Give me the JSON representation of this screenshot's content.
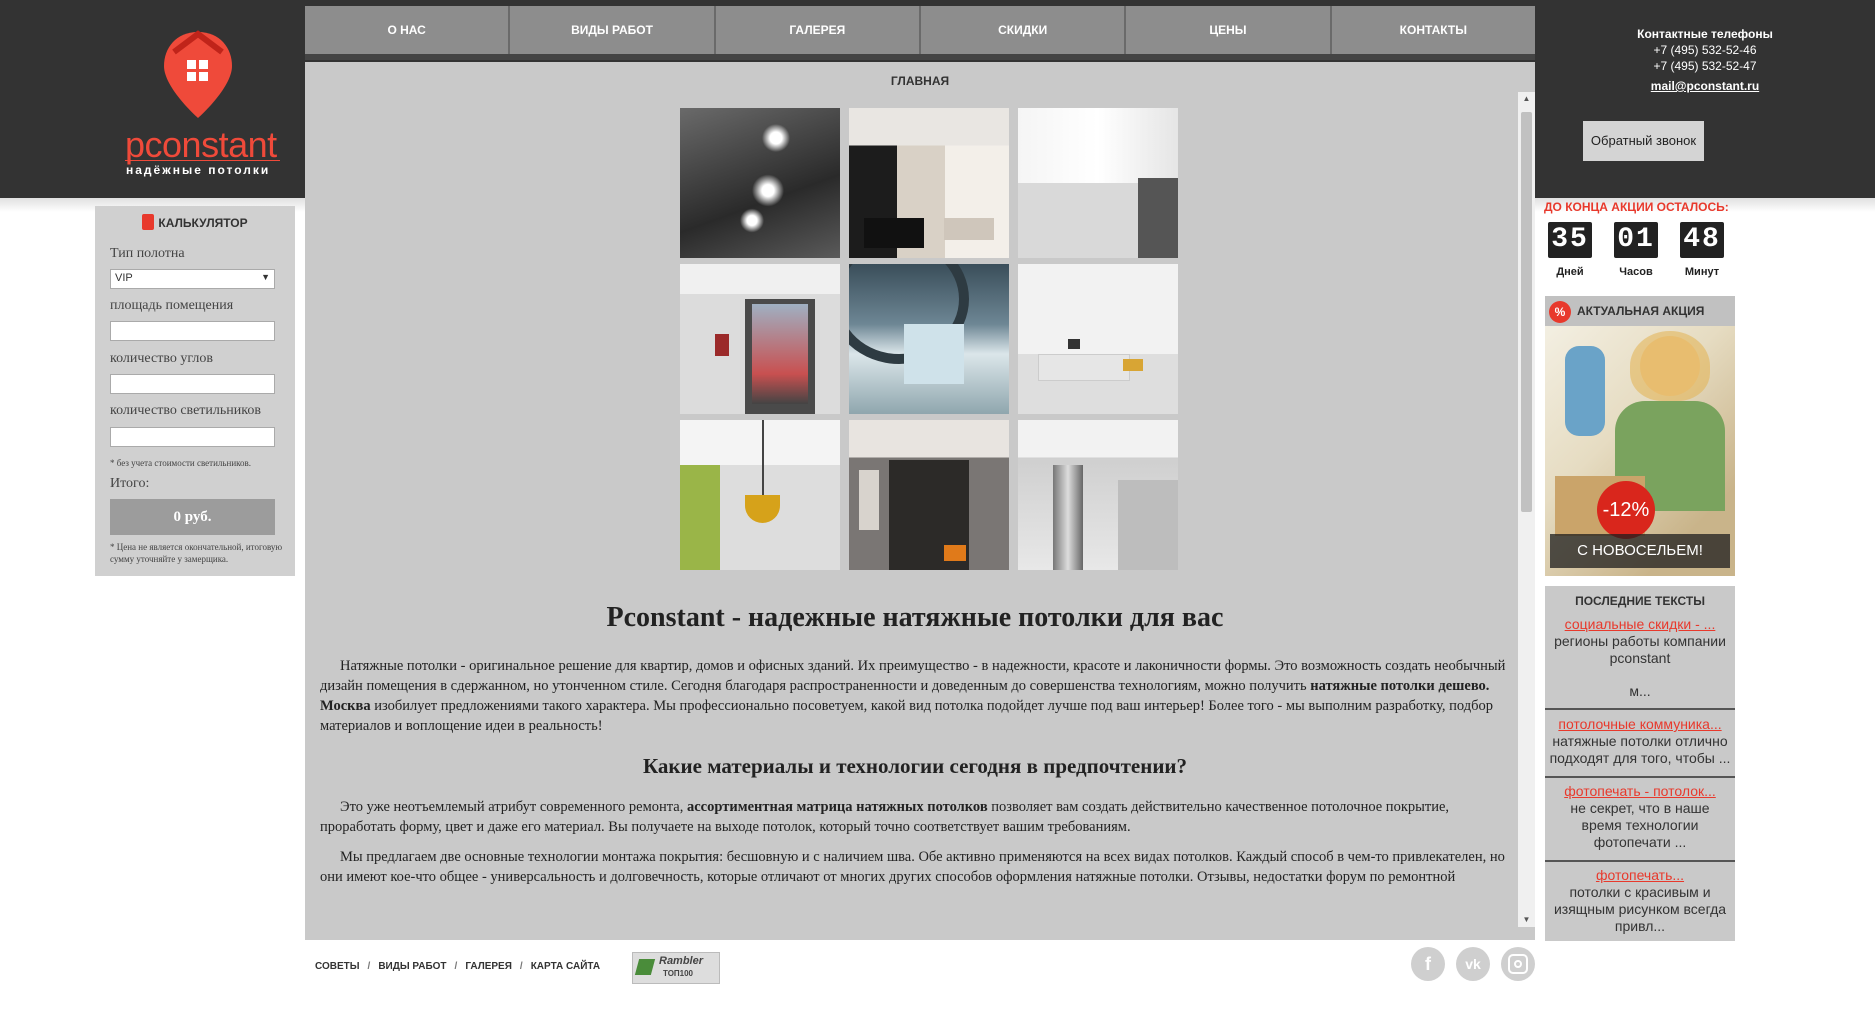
{
  "nav": [
    "О НАС",
    "ВИДЫ РАБОТ",
    "ГАЛЕРЕЯ",
    "СКИДКИ",
    "ЦЕНЫ",
    "КОНТАКТЫ"
  ],
  "logo": {
    "word": "pconstant",
    "sub": "надёжные потолки"
  },
  "breadcrumb": "ГЛАВНАЯ",
  "content": {
    "h1": "Pconstant - надежные натяжные потолки для вас",
    "p1_a": "Натяжные потолки - оригинальное решение для квартир, домов и офисных зданий. Их преимущество - в надежности, красоте и лаконичности формы. Это возможность создать необычный дизайн помещения в сдержанном, но утонченном стиле. Сегодня благодаря распространенности и доведенным до совершенства технологиям, можно получить ",
    "p1_b": "натяжные потолки дешево. Москва",
    "p1_c": " изобилует предложениями такого характера. Мы профессионально посоветуем, какой вид потолка подойдет лучше под ваш интерьер! Более того - мы выполним разработку, подбор материалов и воплощение идеи в реальность!",
    "h2": "Какие материалы и технологии сегодня в предпочтении?",
    "p2_a": "Это уже неотъемлемый атрибут современного ремонта, ",
    "p2_b": "ассортиментная матрица натяжных потолков",
    "p2_c": " позволяет вам создать действительно качественное потолочное покрытие, проработать форму, цвет и даже его материал. Вы получаете на выходе потолок, который точно соответствует вашим требованиям.",
    "p3": "Мы предлагаем две основные технологии монтажа покрытия: бесшовную и с наличием шва. Обе активно применяются на всех видах потолков. Каждый способ в чем-то привлекателен, но они имеют кое-что общее - универсальность и долговечность, которые отличают от многих других способов оформления натяжные потолки. Отзывы, недостатки форум по ремонтной тематике раскрывает несколько шире: в основном пользователи относят к минусу таких потолков их стоимость, однако она очень различна в"
  },
  "calculator": {
    "title": "КАЛЬКУЛЯТОР",
    "type_label": "Тип полотна",
    "type_value": "VIP",
    "area_label": "площадь помещения",
    "corners_label": "количество углов",
    "lamps_label": "количество светильников",
    "lamps_note": "* без учета стоимости светильников.",
    "total_label": "Итого:",
    "total_value": "0 руб.",
    "final_note": "* Цена не является окончательной, итоговую сумму уточняйте у замерщика."
  },
  "contacts": {
    "title": "Контактные телефоны",
    "phone1": "+7 (495) 532-52-46",
    "phone2": "+7 (495) 532-52-47",
    "email": "mail@pconstant.ru",
    "callback": "Обратный звонок"
  },
  "timer": {
    "title": "ДО КОНЦА АКЦИИ ОСТАЛОСЬ:",
    "days": "35",
    "days_label": "Дней",
    "hours": "01",
    "hours_label": "Часов",
    "minutes": "48",
    "minutes_label": "Минут"
  },
  "promo": {
    "title": "АКТУАЛЬНАЯ АКЦИЯ",
    "discount": "-12%",
    "caption": "С НОВОСЕЛЬЕМ!"
  },
  "last_texts": {
    "title": "ПОСЛЕДНИЕ ТЕКСТЫ",
    "items": [
      {
        "link": "социальные скидки - ...",
        "text": "регионы работы компании pconstant",
        "more": "м..."
      },
      {
        "link": "потолочные коммуника...",
        "text": "натяжные потолки отлично подходят для того, чтобы ..."
      },
      {
        "link": "фотопечать - потолок...",
        "text": "не секрет, что в наше время технологии фотопечати ..."
      },
      {
        "link": "фотопечать...",
        "text": "потолки с красивым и изящным рисунком всегда привл..."
      }
    ]
  },
  "footer": {
    "links": [
      "СОВЕТЫ",
      "ВИДЫ РАБОТ",
      "ГАЛЕРЕЯ",
      "КАРТА САЙТА"
    ],
    "counter_a": "Rambler",
    "counter_b": "ТОП100"
  },
  "social": [
    "facebook-icon",
    "vk-icon",
    "instagram-icon"
  ],
  "colors": {
    "accent": "#e8392c",
    "header": "#333333",
    "nav": "#8d8d8d",
    "content_bg": "#c9c9c9"
  }
}
